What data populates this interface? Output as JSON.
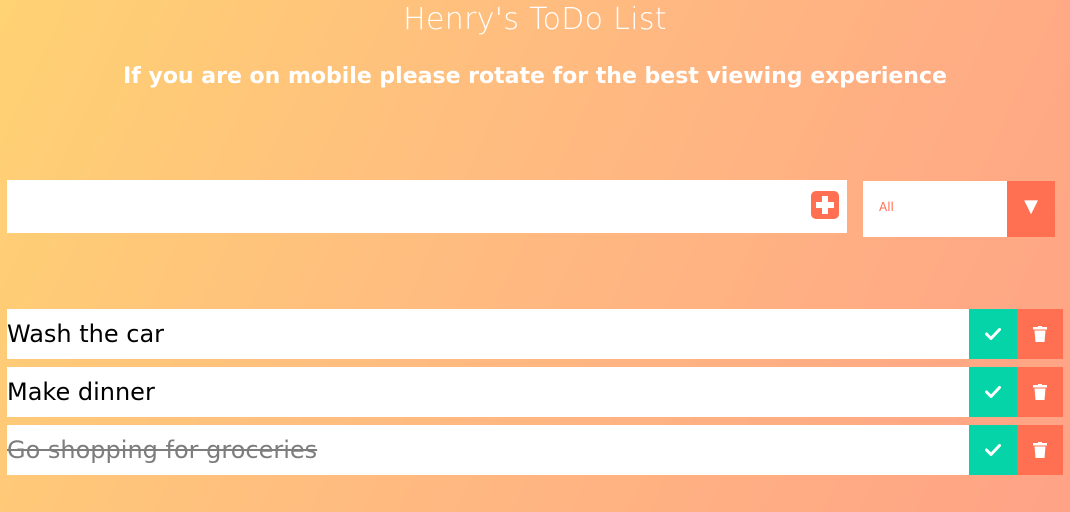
{
  "header": {
    "title": "Henry's ToDo List",
    "subtitle": "If you are on mobile please rotate for the best viewing experience"
  },
  "form": {
    "input_value": "",
    "add_icon": "plus-square-icon",
    "filter": {
      "selected": "All",
      "arrow_icon": "triangle-down-icon"
    }
  },
  "todos": [
    {
      "text": "Wash the car",
      "completed": false
    },
    {
      "text": "Make dinner",
      "completed": false
    },
    {
      "text": "Go shopping for groceries",
      "completed": true
    }
  ],
  "icons": {
    "complete": "check-icon",
    "delete": "trash-icon"
  },
  "colors": {
    "accent": "#ff6f52",
    "complete": "#04d4a8",
    "gradient_start": "#ffd273",
    "gradient_end": "#ffa286",
    "completed_text": "#7d7d7d"
  }
}
